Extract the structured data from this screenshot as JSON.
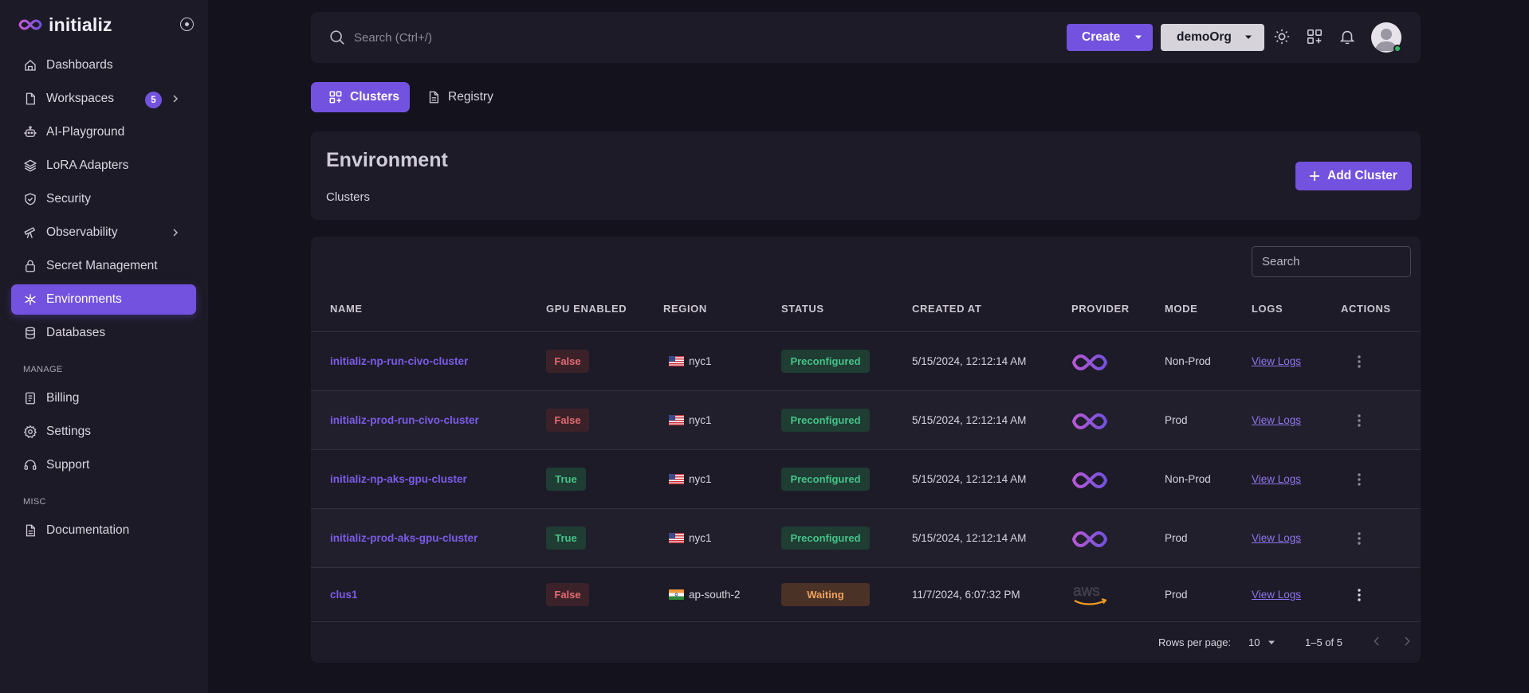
{
  "brand": {
    "name": "initializ"
  },
  "sidebar": {
    "items": [
      {
        "label": "Dashboards",
        "icon": "home-icon"
      },
      {
        "label": "Workspaces",
        "icon": "file-icon",
        "badge": "5"
      },
      {
        "label": "AI-Playground",
        "icon": "robot-icon"
      },
      {
        "label": "LoRA Adapters",
        "icon": "layers-icon"
      },
      {
        "label": "Security",
        "icon": "shield-check-icon"
      },
      {
        "label": "Observability",
        "icon": "telescope-icon"
      },
      {
        "label": "Secret Management",
        "icon": "lock-icon"
      },
      {
        "label": "Environments",
        "icon": "network-icon"
      },
      {
        "label": "Databases",
        "icon": "database-icon"
      }
    ],
    "manage_heading": "MANAGE",
    "manage_items": [
      {
        "label": "Billing",
        "icon": "receipt-icon"
      },
      {
        "label": "Settings",
        "icon": "gear-icon"
      },
      {
        "label": "Support",
        "icon": "headset-icon"
      }
    ],
    "misc_heading": "MISC",
    "misc_items": [
      {
        "label": "Documentation",
        "icon": "document-icon"
      }
    ]
  },
  "topbar": {
    "search_placeholder": "Search (Ctrl+/)",
    "create_label": "Create",
    "org_label": "demoOrg"
  },
  "tabs": [
    {
      "label": "Clusters",
      "active": true
    },
    {
      "label": "Registry",
      "active": false
    }
  ],
  "environment": {
    "title": "Environment",
    "subtitle": "Clusters",
    "add_label": "Add Cluster"
  },
  "table": {
    "search_placeholder": "Search",
    "headers": [
      "NAME",
      "GPU ENABLED",
      "REGION",
      "STATUS",
      "CREATED AT",
      "PROVIDER",
      "MODE",
      "LOGS",
      "ACTIONS"
    ],
    "rows": [
      {
        "name": "initializ-np-run-civo-cluster",
        "gpu": "False",
        "region": "nyc1",
        "flag": "us",
        "status": "Preconfigured",
        "created": "5/15/2024, 12:12:14 AM",
        "provider": "initializ",
        "mode": "Non-Prod",
        "logs": "View Logs"
      },
      {
        "name": "initializ-prod-run-civo-cluster",
        "gpu": "False",
        "region": "nyc1",
        "flag": "us",
        "status": "Preconfigured",
        "created": "5/15/2024, 12:12:14 AM",
        "provider": "initializ",
        "mode": "Prod",
        "logs": "View Logs"
      },
      {
        "name": "initializ-np-aks-gpu-cluster",
        "gpu": "True",
        "region": "nyc1",
        "flag": "us",
        "status": "Preconfigured",
        "created": "5/15/2024, 12:12:14 AM",
        "provider": "initializ",
        "mode": "Non-Prod",
        "logs": "View Logs"
      },
      {
        "name": "initializ-prod-aks-gpu-cluster",
        "gpu": "True",
        "region": "nyc1",
        "flag": "us",
        "status": "Preconfigured",
        "created": "5/15/2024, 12:12:14 AM",
        "provider": "initializ",
        "mode": "Prod",
        "logs": "View Logs"
      },
      {
        "name": "clus1",
        "gpu": "False",
        "region": "ap-south-2",
        "flag": "in",
        "status": "Waiting",
        "created": "11/7/2024, 6:07:32 PM",
        "provider": "aws",
        "mode": "Prod",
        "logs": "View Logs"
      }
    ],
    "footer": {
      "rows_per_page_label": "Rows per page:",
      "rows_per_page_value": "10",
      "range": "1–5 of 5"
    }
  },
  "colors": {
    "accent": "#7352df",
    "background": "#14121c",
    "surface": "#1d1b27"
  }
}
